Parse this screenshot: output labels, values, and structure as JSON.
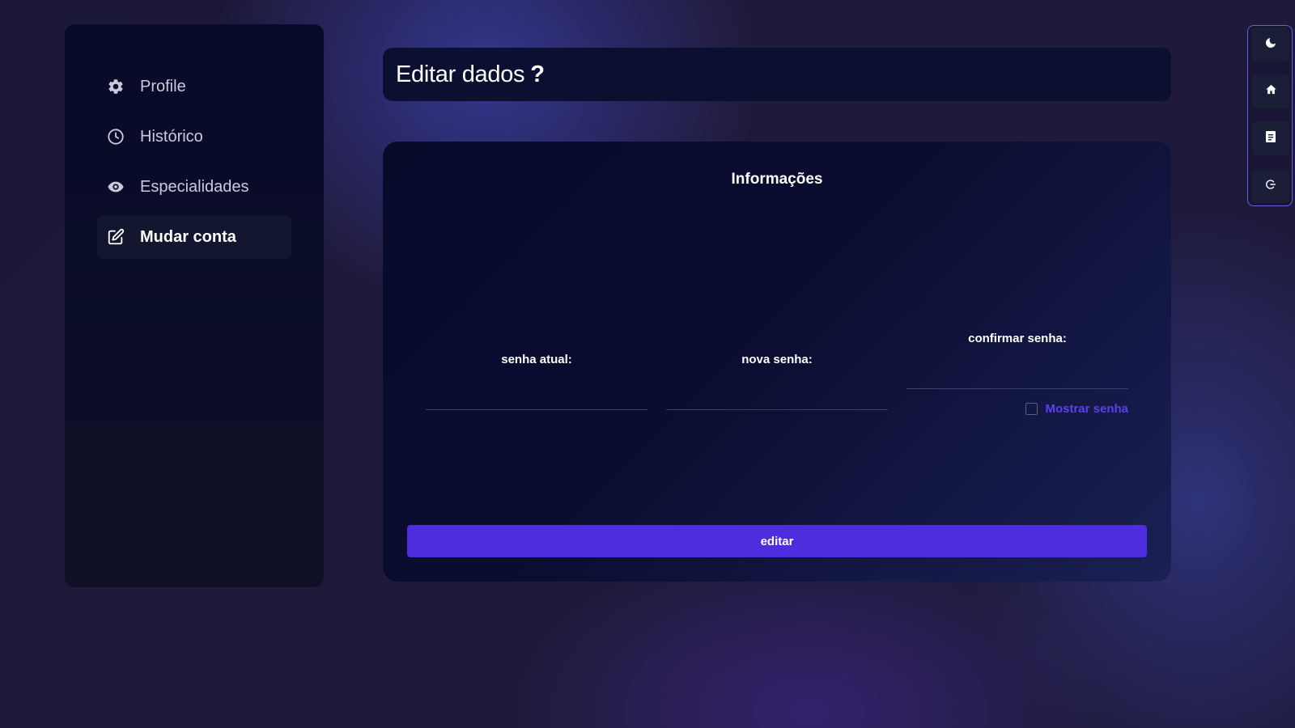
{
  "sidebar": {
    "items": [
      {
        "label": "Profile",
        "icon": "gear-icon",
        "active": false
      },
      {
        "label": "Histórico",
        "icon": "clock-icon",
        "active": false
      },
      {
        "label": "Especialidades",
        "icon": "eye-icon",
        "active": false
      },
      {
        "label": "Mudar conta",
        "icon": "edit-icon",
        "active": true
      }
    ]
  },
  "header": {
    "title": "Editar dados",
    "suffix": "?"
  },
  "form": {
    "title": "Informações",
    "fields": [
      {
        "label": "senha atual:",
        "value": ""
      },
      {
        "label": "nova senha:",
        "value": ""
      },
      {
        "label": "confirmar senha:",
        "value": ""
      }
    ],
    "show_password_label": "Mostrar senha",
    "submit_label": "editar"
  },
  "toolbar": {
    "buttons": [
      {
        "icon": "moon-icon"
      },
      {
        "icon": "home-icon"
      },
      {
        "icon": "document-icon"
      },
      {
        "icon": "logout-icon"
      }
    ]
  },
  "colors": {
    "accent": "#4e2ddf",
    "link": "#5b3ff0",
    "panel": "#0c1030"
  }
}
